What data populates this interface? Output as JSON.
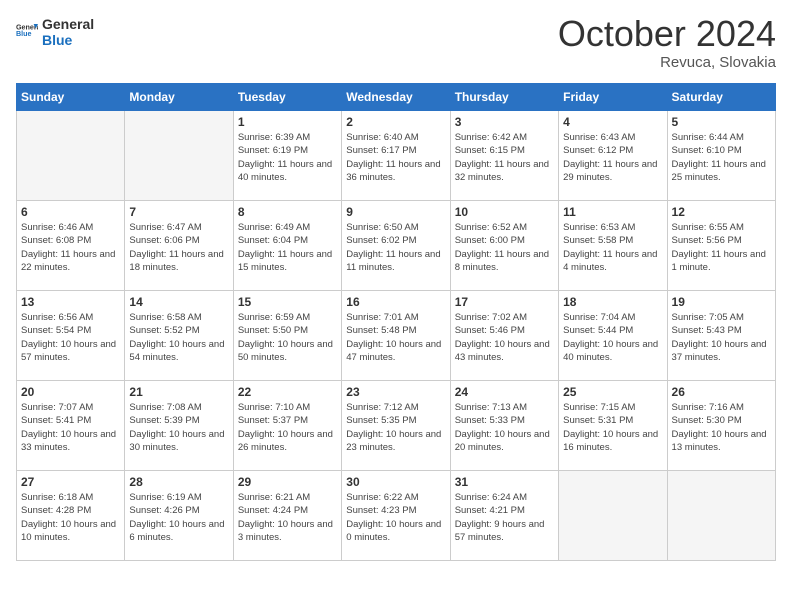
{
  "header": {
    "logo_general": "General",
    "logo_blue": "Blue",
    "month_title": "October 2024",
    "subtitle": "Revuca, Slovakia"
  },
  "weekdays": [
    "Sunday",
    "Monday",
    "Tuesday",
    "Wednesday",
    "Thursday",
    "Friday",
    "Saturday"
  ],
  "weeks": [
    [
      {
        "day": "",
        "sunrise": "",
        "sunset": "",
        "daylight": "",
        "empty": true
      },
      {
        "day": "",
        "sunrise": "",
        "sunset": "",
        "daylight": "",
        "empty": true
      },
      {
        "day": "1",
        "sunrise": "Sunrise: 6:39 AM",
        "sunset": "Sunset: 6:19 PM",
        "daylight": "Daylight: 11 hours and 40 minutes.",
        "empty": false
      },
      {
        "day": "2",
        "sunrise": "Sunrise: 6:40 AM",
        "sunset": "Sunset: 6:17 PM",
        "daylight": "Daylight: 11 hours and 36 minutes.",
        "empty": false
      },
      {
        "day": "3",
        "sunrise": "Sunrise: 6:42 AM",
        "sunset": "Sunset: 6:15 PM",
        "daylight": "Daylight: 11 hours and 32 minutes.",
        "empty": false
      },
      {
        "day": "4",
        "sunrise": "Sunrise: 6:43 AM",
        "sunset": "Sunset: 6:12 PM",
        "daylight": "Daylight: 11 hours and 29 minutes.",
        "empty": false
      },
      {
        "day": "5",
        "sunrise": "Sunrise: 6:44 AM",
        "sunset": "Sunset: 6:10 PM",
        "daylight": "Daylight: 11 hours and 25 minutes.",
        "empty": false
      }
    ],
    [
      {
        "day": "6",
        "sunrise": "Sunrise: 6:46 AM",
        "sunset": "Sunset: 6:08 PM",
        "daylight": "Daylight: 11 hours and 22 minutes.",
        "empty": false
      },
      {
        "day": "7",
        "sunrise": "Sunrise: 6:47 AM",
        "sunset": "Sunset: 6:06 PM",
        "daylight": "Daylight: 11 hours and 18 minutes.",
        "empty": false
      },
      {
        "day": "8",
        "sunrise": "Sunrise: 6:49 AM",
        "sunset": "Sunset: 6:04 PM",
        "daylight": "Daylight: 11 hours and 15 minutes.",
        "empty": false
      },
      {
        "day": "9",
        "sunrise": "Sunrise: 6:50 AM",
        "sunset": "Sunset: 6:02 PM",
        "daylight": "Daylight: 11 hours and 11 minutes.",
        "empty": false
      },
      {
        "day": "10",
        "sunrise": "Sunrise: 6:52 AM",
        "sunset": "Sunset: 6:00 PM",
        "daylight": "Daylight: 11 hours and 8 minutes.",
        "empty": false
      },
      {
        "day": "11",
        "sunrise": "Sunrise: 6:53 AM",
        "sunset": "Sunset: 5:58 PM",
        "daylight": "Daylight: 11 hours and 4 minutes.",
        "empty": false
      },
      {
        "day": "12",
        "sunrise": "Sunrise: 6:55 AM",
        "sunset": "Sunset: 5:56 PM",
        "daylight": "Daylight: 11 hours and 1 minute.",
        "empty": false
      }
    ],
    [
      {
        "day": "13",
        "sunrise": "Sunrise: 6:56 AM",
        "sunset": "Sunset: 5:54 PM",
        "daylight": "Daylight: 10 hours and 57 minutes.",
        "empty": false
      },
      {
        "day": "14",
        "sunrise": "Sunrise: 6:58 AM",
        "sunset": "Sunset: 5:52 PM",
        "daylight": "Daylight: 10 hours and 54 minutes.",
        "empty": false
      },
      {
        "day": "15",
        "sunrise": "Sunrise: 6:59 AM",
        "sunset": "Sunset: 5:50 PM",
        "daylight": "Daylight: 10 hours and 50 minutes.",
        "empty": false
      },
      {
        "day": "16",
        "sunrise": "Sunrise: 7:01 AM",
        "sunset": "Sunset: 5:48 PM",
        "daylight": "Daylight: 10 hours and 47 minutes.",
        "empty": false
      },
      {
        "day": "17",
        "sunrise": "Sunrise: 7:02 AM",
        "sunset": "Sunset: 5:46 PM",
        "daylight": "Daylight: 10 hours and 43 minutes.",
        "empty": false
      },
      {
        "day": "18",
        "sunrise": "Sunrise: 7:04 AM",
        "sunset": "Sunset: 5:44 PM",
        "daylight": "Daylight: 10 hours and 40 minutes.",
        "empty": false
      },
      {
        "day": "19",
        "sunrise": "Sunrise: 7:05 AM",
        "sunset": "Sunset: 5:43 PM",
        "daylight": "Daylight: 10 hours and 37 minutes.",
        "empty": false
      }
    ],
    [
      {
        "day": "20",
        "sunrise": "Sunrise: 7:07 AM",
        "sunset": "Sunset: 5:41 PM",
        "daylight": "Daylight: 10 hours and 33 minutes.",
        "empty": false
      },
      {
        "day": "21",
        "sunrise": "Sunrise: 7:08 AM",
        "sunset": "Sunset: 5:39 PM",
        "daylight": "Daylight: 10 hours and 30 minutes.",
        "empty": false
      },
      {
        "day": "22",
        "sunrise": "Sunrise: 7:10 AM",
        "sunset": "Sunset: 5:37 PM",
        "daylight": "Daylight: 10 hours and 26 minutes.",
        "empty": false
      },
      {
        "day": "23",
        "sunrise": "Sunrise: 7:12 AM",
        "sunset": "Sunset: 5:35 PM",
        "daylight": "Daylight: 10 hours and 23 minutes.",
        "empty": false
      },
      {
        "day": "24",
        "sunrise": "Sunrise: 7:13 AM",
        "sunset": "Sunset: 5:33 PM",
        "daylight": "Daylight: 10 hours and 20 minutes.",
        "empty": false
      },
      {
        "day": "25",
        "sunrise": "Sunrise: 7:15 AM",
        "sunset": "Sunset: 5:31 PM",
        "daylight": "Daylight: 10 hours and 16 minutes.",
        "empty": false
      },
      {
        "day": "26",
        "sunrise": "Sunrise: 7:16 AM",
        "sunset": "Sunset: 5:30 PM",
        "daylight": "Daylight: 10 hours and 13 minutes.",
        "empty": false
      }
    ],
    [
      {
        "day": "27",
        "sunrise": "Sunrise: 6:18 AM",
        "sunset": "Sunset: 4:28 PM",
        "daylight": "Daylight: 10 hours and 10 minutes.",
        "empty": false
      },
      {
        "day": "28",
        "sunrise": "Sunrise: 6:19 AM",
        "sunset": "Sunset: 4:26 PM",
        "daylight": "Daylight: 10 hours and 6 minutes.",
        "empty": false
      },
      {
        "day": "29",
        "sunrise": "Sunrise: 6:21 AM",
        "sunset": "Sunset: 4:24 PM",
        "daylight": "Daylight: 10 hours and 3 minutes.",
        "empty": false
      },
      {
        "day": "30",
        "sunrise": "Sunrise: 6:22 AM",
        "sunset": "Sunset: 4:23 PM",
        "daylight": "Daylight: 10 hours and 0 minutes.",
        "empty": false
      },
      {
        "day": "31",
        "sunrise": "Sunrise: 6:24 AM",
        "sunset": "Sunset: 4:21 PM",
        "daylight": "Daylight: 9 hours and 57 minutes.",
        "empty": false
      },
      {
        "day": "",
        "sunrise": "",
        "sunset": "",
        "daylight": "",
        "empty": true
      },
      {
        "day": "",
        "sunrise": "",
        "sunset": "",
        "daylight": "",
        "empty": true
      }
    ]
  ]
}
